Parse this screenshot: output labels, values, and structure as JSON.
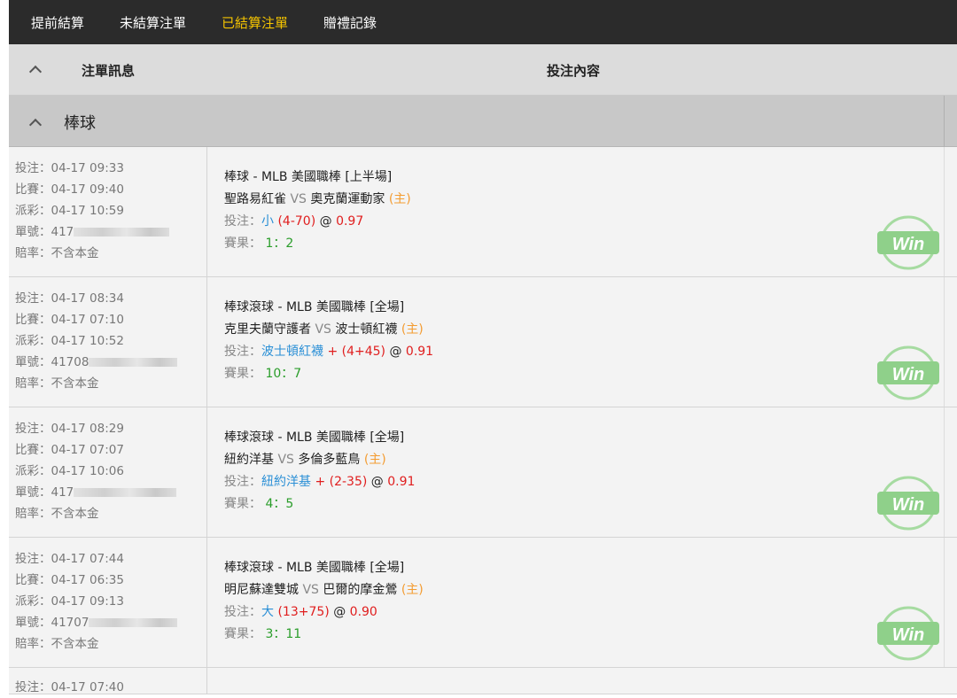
{
  "tabs": [
    "提前結算",
    "未結算注單",
    "已結算注單",
    "贈禮記錄"
  ],
  "active_tab": 2,
  "header": {
    "col1": "注單訊息",
    "col2": "投注內容"
  },
  "sport_group": {
    "name": "棒球"
  },
  "labels": {
    "bet_time": "投注：",
    "match_time": "比賽：",
    "payout_time": "派彩：",
    "ticket": "單號：",
    "odds_type_label": "賠率：",
    "odds_type_value": "不含本金",
    "vs": "VS",
    "home": "(主)",
    "bet": "投注：",
    "at": "@",
    "result": "賽果：",
    "win_badge": "Win"
  },
  "bets": [
    {
      "bet_time": "04-17 09:33",
      "match_time": "04-17 09:40",
      "payout_time": "04-17 10:59",
      "ticket_prefix": "417",
      "league": "棒球 - MLB 美國職棒 [上半場]",
      "team_a": "聖路易紅雀",
      "team_b": "奧克蘭運動家",
      "pick": "小",
      "line": "(4-70)",
      "odds": "0.97",
      "result": "1：2"
    },
    {
      "bet_time": "04-17 08:34",
      "match_time": "04-17 07:10",
      "payout_time": "04-17 10:52",
      "ticket_prefix": "41708",
      "league": "棒球滾球 - MLB 美國職棒 [全場]",
      "team_a": "克里夫蘭守護者",
      "team_b": "波士頓紅襪",
      "pick": "波士頓紅襪",
      "line": "+ (4+45)",
      "odds": "0.91",
      "result": "10：7"
    },
    {
      "bet_time": "04-17 08:29",
      "match_time": "04-17 07:07",
      "payout_time": "04-17 10:06",
      "ticket_prefix": "417",
      "league": "棒球滾球 - MLB 美國職棒 [全場]",
      "team_a": "紐約洋基",
      "team_b": "多倫多藍鳥",
      "pick": "紐約洋基",
      "line": "+ (2-35)",
      "odds": "0.91",
      "result": "4：5"
    },
    {
      "bet_time": "04-17 07:44",
      "match_time": "04-17 06:35",
      "payout_time": "04-17 09:13",
      "ticket_prefix": "41707",
      "league": "棒球滾球 - MLB 美國職棒 [全場]",
      "team_a": "明尼蘇達雙城",
      "team_b": "巴爾的摩金鶯",
      "pick": "大",
      "line": "(13+75)",
      "odds": "0.90",
      "result": "3：11"
    }
  ],
  "partial_row": {
    "bet_time": "04-17 07:40"
  },
  "colors": {
    "nav_bg": "#2b2b2b",
    "active_tab": "#f5c400",
    "pick": "#2a8fd6",
    "line": "#e01e1e",
    "result": "#2a9d2a",
    "home": "#f39c32",
    "win_badge": "#8fd08a"
  }
}
